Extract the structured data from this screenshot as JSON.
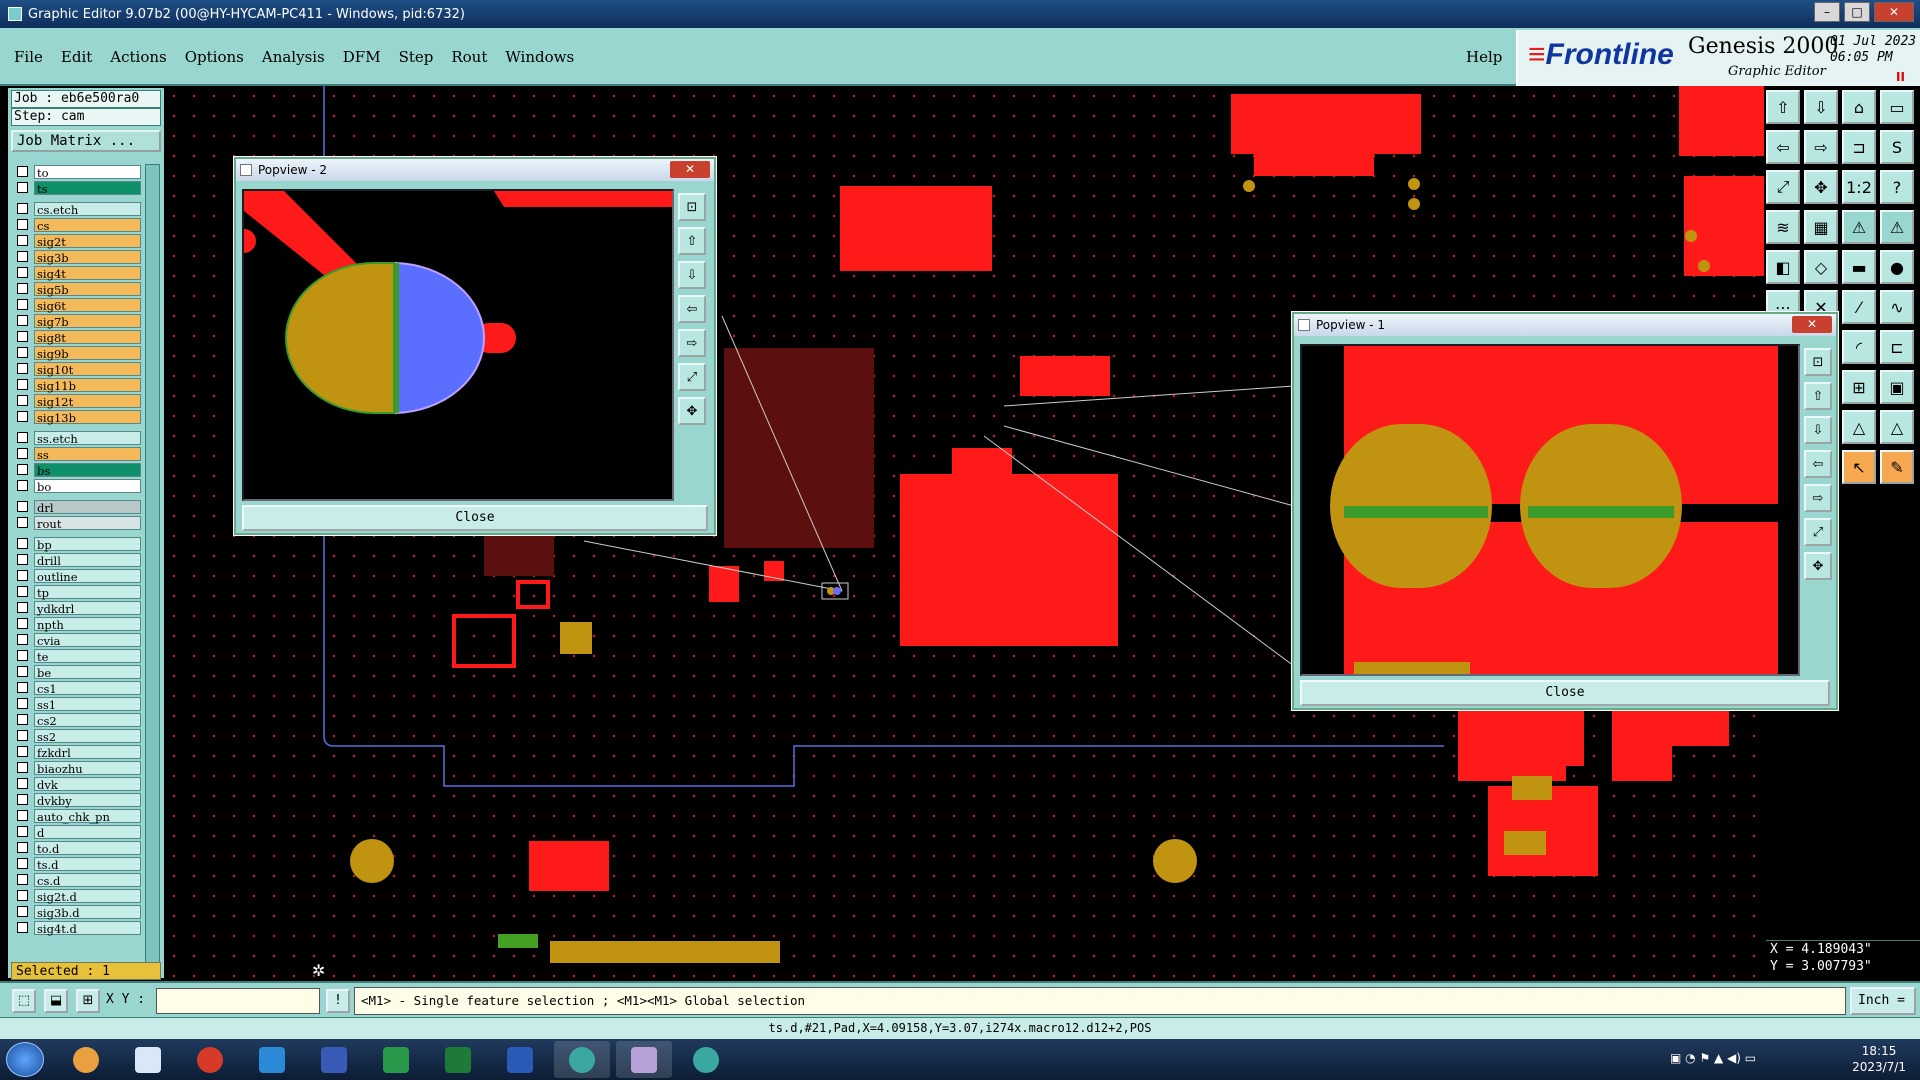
{
  "window": {
    "title": "Graphic Editor 9.07b2 (00@HY-HYCAM-PC411 - Windows, pid:6732)",
    "min": "–",
    "max": "□",
    "close": "✕"
  },
  "menu": {
    "items": [
      "File",
      "Edit",
      "Actions",
      "Options",
      "Analysis",
      "DFM",
      "Step",
      "Rout",
      "Windows"
    ],
    "help": "Help"
  },
  "brand": {
    "logo": "Frontline",
    "product": "Genesis 2000",
    "subtitle": "Graphic Editor",
    "date": "01 Jul 2023",
    "time": "06:05 PM",
    "pause": "II"
  },
  "job": {
    "job_label": "Job : eb6e500ra0",
    "step_label": "Step: cam",
    "matrix_button": "Job Matrix ..."
  },
  "colors": {
    "panel": "#9ad6d0",
    "copper": "#ff1a1a",
    "pad": "#c09410",
    "selected": "#e8c13a"
  },
  "layers": [
    {
      "name": "to",
      "color": "#ffffff"
    },
    {
      "name": "ts",
      "color": "#0f8f6a"
    },
    {
      "name": "cs.etch",
      "color": "#c8ece8"
    },
    {
      "name": "cs",
      "color": "#f4b95a"
    },
    {
      "name": "sig2t",
      "color": "#f4b95a"
    },
    {
      "name": "sig3b",
      "color": "#f4b95a"
    },
    {
      "name": "sig4t",
      "color": "#f4b95a"
    },
    {
      "name": "sig5b",
      "color": "#f4b95a"
    },
    {
      "name": "sig6t",
      "color": "#f4b95a"
    },
    {
      "name": "sig7b",
      "color": "#f4b95a"
    },
    {
      "name": "sig8t",
      "color": "#f4b95a"
    },
    {
      "name": "sig9b",
      "color": "#f4b95a"
    },
    {
      "name": "sig10t",
      "color": "#f4b95a"
    },
    {
      "name": "sig11b",
      "color": "#f4b95a"
    },
    {
      "name": "sig12t",
      "color": "#f4b95a"
    },
    {
      "name": "sig13b",
      "color": "#f4b95a"
    },
    {
      "name": "ss.etch",
      "color": "#c8ece8"
    },
    {
      "name": "ss",
      "color": "#f4b95a"
    },
    {
      "name": "bs",
      "color": "#0f8f6a"
    },
    {
      "name": "bo",
      "color": "#ffffff"
    },
    {
      "name": "drl",
      "color": "#b8c8c8"
    },
    {
      "name": "rout",
      "color": "#d8e4e4"
    },
    {
      "name": "bp",
      "color": "#c8ece8"
    },
    {
      "name": "drill",
      "color": "#c8ece8"
    },
    {
      "name": "outline",
      "color": "#c8ece8"
    },
    {
      "name": "tp",
      "color": "#c8ece8"
    },
    {
      "name": "ydkdrl",
      "color": "#c8ece8"
    },
    {
      "name": "npth",
      "color": "#c8ece8"
    },
    {
      "name": "cvia",
      "color": "#c8ece8"
    },
    {
      "name": "te",
      "color": "#c8ece8"
    },
    {
      "name": "be",
      "color": "#c8ece8"
    },
    {
      "name": "cs1",
      "color": "#c8ece8"
    },
    {
      "name": "ss1",
      "color": "#c8ece8"
    },
    {
      "name": "cs2",
      "color": "#c8ece8"
    },
    {
      "name": "ss2",
      "color": "#c8ece8"
    },
    {
      "name": "fzkdrl",
      "color": "#c8ece8"
    },
    {
      "name": "biaozhu",
      "color": "#c8ece8"
    },
    {
      "name": "dvk",
      "color": "#c8ece8"
    },
    {
      "name": "dvkby",
      "color": "#c8ece8"
    },
    {
      "name": "auto_chk_pn",
      "color": "#c8ece8"
    },
    {
      "name": "d",
      "color": "#c8ece8"
    },
    {
      "name": "to.d",
      "color": "#c8ece8"
    },
    {
      "name": "ts.d",
      "color": "#c8ece8"
    },
    {
      "name": "cs.d",
      "color": "#c8ece8"
    },
    {
      "name": "sig2t.d",
      "color": "#c8ece8"
    },
    {
      "name": "sig3b.d",
      "color": "#c8ece8"
    },
    {
      "name": "sig4t.d",
      "color": "#c8ece8"
    }
  ],
  "selected_label": "Selected : 1",
  "coords": {
    "x": "X = 4.189043\"",
    "y": "Y = 3.007793\""
  },
  "bottom": {
    "xy_label": "X Y :",
    "xy_value": "",
    "excl": "!",
    "hint": "<M1> - Single feature selection ; <M1><M1> Global selection",
    "units": "Inch ="
  },
  "status": "ts.d,#21,Pad,X=4.09158,Y=3.07,i274x.macro12.d12+2,POS",
  "popview2": {
    "title": "Popview - 2",
    "close_label": "Close"
  },
  "popview1": {
    "title": "Popview - 1",
    "close_label": "Close"
  },
  "tray": {
    "time": "18:15",
    "date": "2023/7/1"
  }
}
